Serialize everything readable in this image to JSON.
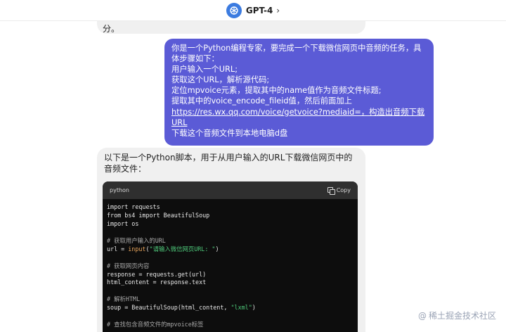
{
  "header": {
    "model": "GPT-4",
    "chevron": "›"
  },
  "previous": {
    "text": "分。"
  },
  "user_message": {
    "line1": "你是一个Python编程专家，要完成一个下载微信网页中音频的任务，具体步骤如下：",
    "line2": "用户输入一个URL;",
    "line3": "获取这个URL，解析源代码;",
    "line4": "定位mpvoice元素，提取其中的name值作为音频文件标题;",
    "line5": "提取其中的voice_encode_fileid值，然后前面加上",
    "link": "https://res.wx.qq.com/voice/getvoice?mediaid=，构造出音频下载URL",
    "line6": "下载这个音频文件到本地电脑d盘"
  },
  "assistant_message": {
    "intro": "以下是一个Python脚本，用于从用户输入的URL下载微信网页中的音频文件："
  },
  "code_block": {
    "language": "python",
    "copy_label": "Copy",
    "lines": {
      "l1": "import requests",
      "l2": "from bs4 import BeautifulSoup",
      "l3": "import os",
      "l5": "# 获取用户输入的URL",
      "l6a": "url = ",
      "l6b": "input",
      "l6c": "(",
      "l6d": "\"请输入微信网页URL: \"",
      "l6e": ")",
      "l8": "# 获取网页内容",
      "l9": "response = requests.get(url)",
      "l10": "html_content = response.text",
      "l12": "# 解析HTML",
      "l13a": "soup = BeautifulSoup(html_content, ",
      "l13b": "\"lxml\"",
      "l13c": ")",
      "l15": "# 查找包含音频文件的mpvoice标签"
    }
  },
  "watermark": {
    "text": "稀土掘金技术社区",
    "icon": "@"
  }
}
